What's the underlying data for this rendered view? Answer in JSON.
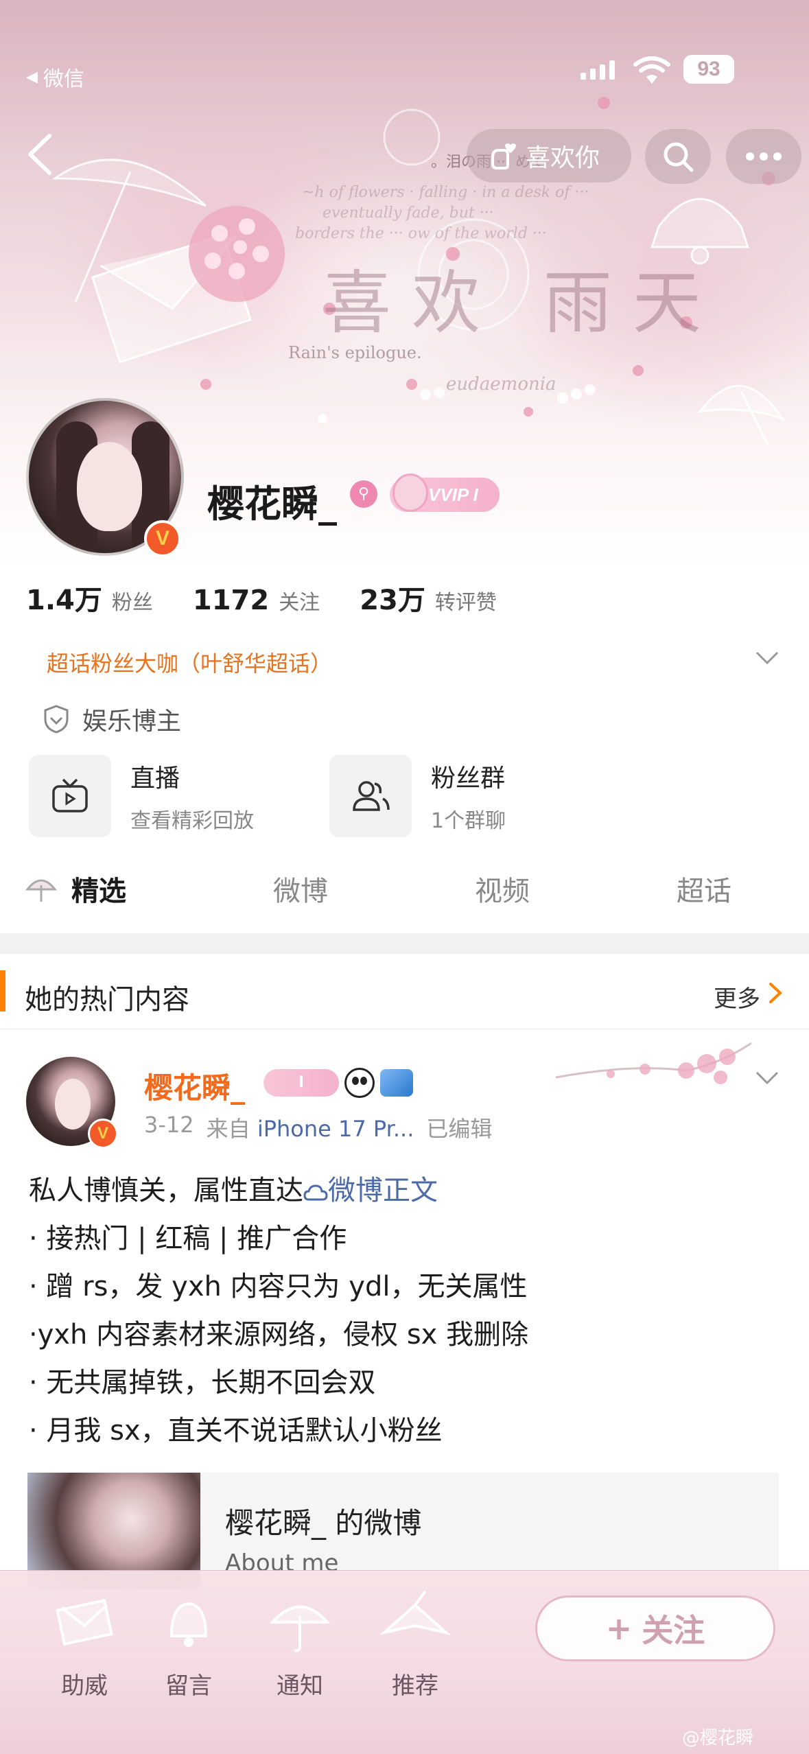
{
  "status_bar": {
    "back_app": "微信",
    "battery": "93"
  },
  "nav": {
    "like_label": "喜欢你",
    "header_caption": "。泪の雨 ··· めて"
  },
  "hero_art": {
    "title_chars": "喜欢 雨天",
    "caption": "Rain's epilogue.",
    "word": "eudaemonia"
  },
  "profile": {
    "username": "樱花瞬_",
    "vip_label": "VVIP I",
    "stats": [
      {
        "num": "1.4万",
        "label": "粉丝"
      },
      {
        "num": "1172",
        "label": "关注"
      },
      {
        "num": "23万",
        "label": "转评赞"
      }
    ],
    "super_fan": "超话粉丝大咖（叶舒华超话）",
    "verify": "娱乐博主",
    "quick": [
      {
        "title": "直播",
        "sub": "查看精彩回放",
        "icon": "tv-icon"
      },
      {
        "title": "粉丝群",
        "sub": "1个群聊",
        "icon": "group-icon"
      }
    ]
  },
  "tabs": [
    "精选",
    "微博",
    "视频",
    "超话"
  ],
  "section": {
    "title": "她的热门内容",
    "more": "更多"
  },
  "post": {
    "name": "樱花瞬_",
    "badge_vip": "I",
    "date": "3-12",
    "from": "来自",
    "source": "iPhone 17 Pr...",
    "edited": "已编辑",
    "lines": [
      {
        "text": "私人博慎关，属性直达",
        "link": "微博正文"
      },
      {
        "text": "· 接热门 | 红稿 | 推广合作"
      },
      {
        "text": "· 蹭 rs，发 yxh 内容只为 ydl，无关属性"
      },
      {
        "text": "·yxh 内容素材来源网络，侵权 sx 我删除"
      },
      {
        "text": "· 无共属掉铁，长期不回会双"
      },
      {
        "text": "· 月我 sx，直关不说话默认小粉丝"
      }
    ],
    "card": {
      "title": "樱花瞬_ 的微博",
      "sub": "About me"
    }
  },
  "bottom_bar": {
    "items": [
      "助威",
      "留言",
      "通知",
      "推荐"
    ],
    "follow": "关注"
  },
  "watermark": "@樱花瞬"
}
